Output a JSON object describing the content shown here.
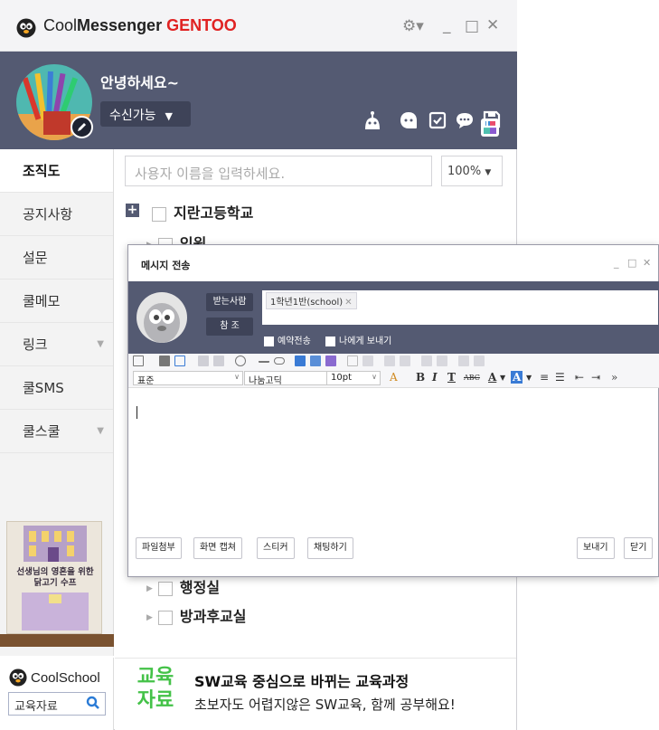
{
  "app": {
    "title_part1": "Cool",
    "title_part2": "Messenger",
    "title_part3": "GENTOO"
  },
  "profile": {
    "greeting": "안녕하세요~",
    "status": "수신가능"
  },
  "search": {
    "placeholder": "사용자 이름을 입력하세요.",
    "zoom": "100%"
  },
  "sidebar": {
    "items": [
      {
        "label": "조직도"
      },
      {
        "label": "공지사항"
      },
      {
        "label": "설문"
      },
      {
        "label": "쿨메모"
      },
      {
        "label": "링크"
      },
      {
        "label": "쿨SMS"
      },
      {
        "label": "쿨스쿨"
      }
    ]
  },
  "book": {
    "title_line1": "선생님의 영혼을 위한",
    "title_line2": "닭고기 수프"
  },
  "coolschool": {
    "label": "CoolSchool",
    "search_value": "교육자료"
  },
  "tree": {
    "root": "지란고등학교",
    "child_partial": "임원",
    "child_hidden": "행정실",
    "child_last": "방과후교실"
  },
  "ad": {
    "icon_line1": "교육",
    "icon_line2": "자료",
    "title": "SW교육 중심으로 바뀌는 교육과정",
    "subtitle": "초보자도 어렵지않은 SW교육, 함께 공부해요!"
  },
  "message_dialog": {
    "title": "메시지 전송",
    "to_label": "받는사람",
    "cc_label": "참  조",
    "recipient": "1학년1반(school)",
    "reserve_label": "예약전송",
    "self_label": "나에게 보내기",
    "style_value": "표준",
    "font_value": "나눔고딕",
    "size_value": "10pt",
    "buttons": {
      "attach": "파일첨부",
      "capture": "화면 캡쳐",
      "sticker": "스티커",
      "chat": "채팅하기",
      "send": "보내기",
      "close": "닫기"
    }
  },
  "colors": {
    "header_bg": "#545a72",
    "brand_red": "#e02222",
    "ad_green": "#44c248"
  }
}
